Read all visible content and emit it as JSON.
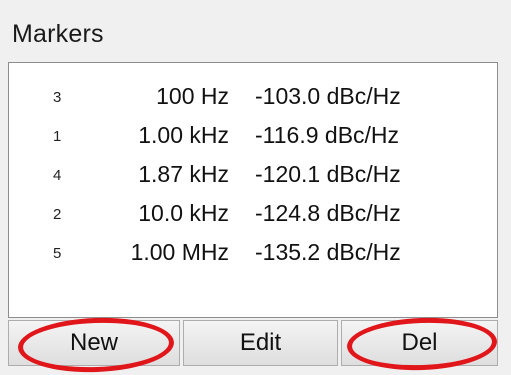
{
  "panel": {
    "title": "Markers"
  },
  "markers": [
    {
      "index": "3",
      "frequency": "100 Hz",
      "value": "-103.0 dBc/Hz"
    },
    {
      "index": "1",
      "frequency": "1.00 kHz",
      "value": "-116.9 dBc/Hz"
    },
    {
      "index": "4",
      "frequency": "1.87 kHz",
      "value": "-120.1 dBc/Hz"
    },
    {
      "index": "2",
      "frequency": "10.0 kHz",
      "value": "-124.8 dBc/Hz"
    },
    {
      "index": "5",
      "frequency": "1.00 MHz",
      "value": "-135.2 dBc/Hz"
    }
  ],
  "buttons": {
    "new_label": "New",
    "edit_label": "Edit",
    "del_label": "Del"
  },
  "colors": {
    "highlight": "#e0161b"
  }
}
